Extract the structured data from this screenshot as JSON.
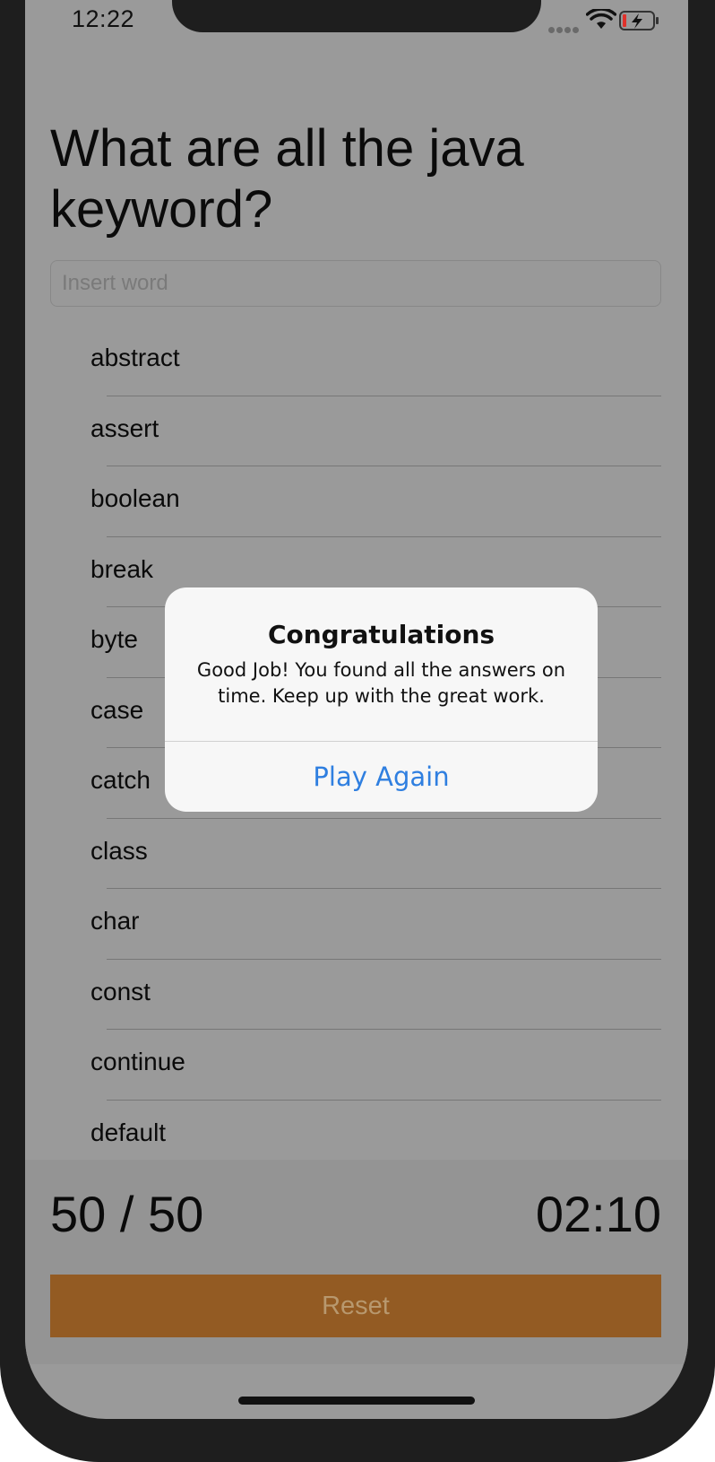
{
  "status_bar": {
    "time": "12:22",
    "wifi_icon": "wifi-icon",
    "battery_icon": "battery-charging-icon",
    "battery_color": "#e0312b"
  },
  "quiz": {
    "question": "What are all the java keyword?",
    "input_placeholder": "Insert word",
    "input_value": ""
  },
  "words": [
    "abstract",
    "assert",
    "boolean",
    "break",
    "byte",
    "case",
    "catch",
    "class",
    "char",
    "const",
    "continue",
    "default"
  ],
  "footer": {
    "score": "50 / 50",
    "timer": "02:10",
    "reset_label": "Reset",
    "reset_color": "#935b23"
  },
  "alert": {
    "title": "Congratulations",
    "message": "Good Job! You found all the answers on time. Keep up with the great work.",
    "button_label": "Play Again",
    "button_color": "#2f7fe0"
  }
}
